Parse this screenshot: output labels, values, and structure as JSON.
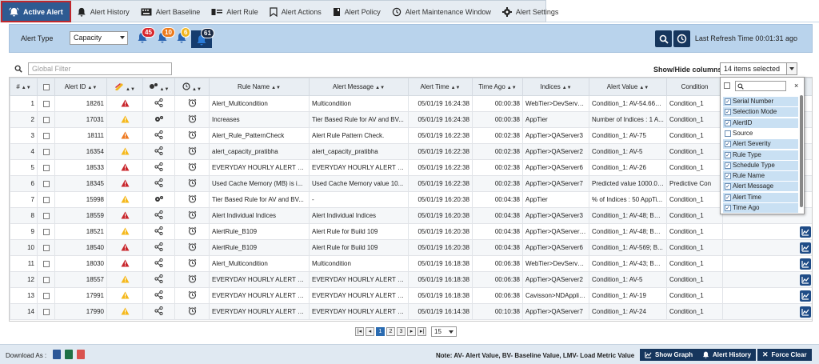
{
  "tabs": [
    {
      "label": "Active Alert",
      "icon": "bell-alert-icon"
    },
    {
      "label": "Alert History",
      "icon": "bell-icon"
    },
    {
      "label": "Alert Baseline",
      "icon": "keyboard-icon"
    },
    {
      "label": "Alert Rule",
      "icon": "rule-icon"
    },
    {
      "label": "Alert Actions",
      "icon": "bookmark-icon"
    },
    {
      "label": "Alert Policy",
      "icon": "book-icon"
    },
    {
      "label": "Alert Maintenance Window",
      "icon": "clock-reset-icon"
    },
    {
      "label": "Alert Settings",
      "icon": "gear-icon"
    }
  ],
  "toolbar": {
    "alert_type_label": "Alert Type",
    "alert_type_value": "Capacity",
    "counts": [
      {
        "value": "45",
        "color": "#d9262c"
      },
      {
        "value": "10",
        "color": "#ec7a1c"
      },
      {
        "value": "6",
        "color": "#f2b51d"
      },
      {
        "value": "61",
        "color": "#1a2a44"
      }
    ],
    "refresh_text": "Last Refresh Time 00:01:31 ago"
  },
  "filter": {
    "placeholder": "Global Filter",
    "show_hide_label": "Show/Hide columns",
    "show_hide_value": "14 items selected"
  },
  "columns": [
    "#",
    "",
    "Alert ID",
    "",
    "",
    "",
    "Rule Name",
    "Alert Message",
    "Alert Time",
    "Time Ago",
    "Indices",
    "Alert Value",
    "Condition"
  ],
  "rows": [
    {
      "n": "1",
      "id": "18261",
      "sev": "red",
      "rt": "share",
      "rule": "Alert_Multicondition",
      "msg": "Multicondition",
      "time": "05/01/19 16:24:38",
      "ago": "00:00:38",
      "idx": "WebTier>DevServer5",
      "val": "Condition_1: AV-54.667...",
      "cond": "Condition_1"
    },
    {
      "n": "2",
      "id": "17031",
      "sev": "yellow",
      "rt": "gears",
      "rule": "Increases",
      "msg": "Tier Based Rule for AV and BV...",
      "time": "05/01/19 16:24:38",
      "ago": "00:00:38",
      "idx": "AppTier",
      "val": "Number of Indices : 1 A...",
      "cond": "Condition_1"
    },
    {
      "n": "3",
      "id": "18111",
      "sev": "orange",
      "rt": "share",
      "rule": "Alert_Rule_PatternCheck",
      "msg": "Alert Rule Pattern Check.",
      "time": "05/01/19 16:22:38",
      "ago": "00:02:38",
      "idx": "AppTier>QAServer3",
      "val": "Condition_1: AV-75",
      "cond": "Condition_1"
    },
    {
      "n": "4",
      "id": "16354",
      "sev": "yellow",
      "rt": "share",
      "rule": "alert_capacity_pratibha",
      "msg": "alert_capacity_pratibha",
      "time": "05/01/19 16:22:38",
      "ago": "00:02:38",
      "idx": "AppTier>QAServer2",
      "val": "Condition_1: AV-5",
      "cond": "Condition_1"
    },
    {
      "n": "5",
      "id": "18533",
      "sev": "red",
      "rt": "share",
      "rule": "EVERYDAY HOURLY ALERT SC...",
      "msg": "EVERYDAY HOURLY ALERT SC...",
      "time": "05/01/19 16:22:38",
      "ago": "00:02:38",
      "idx": "AppTier>QAServer6",
      "val": "Condition_1: AV-26",
      "cond": "Condition_1"
    },
    {
      "n": "6",
      "id": "18345",
      "sev": "red",
      "rt": "share",
      "rule": "Used Cache Memory (MB) is i...",
      "msg": "Used Cache Memory value 10...",
      "time": "05/01/19 16:22:38",
      "ago": "00:02:38",
      "idx": "AppTier>QAServer7",
      "val": "Predicted value 1000.0 ...",
      "cond": "Predictive Con"
    },
    {
      "n": "7",
      "id": "15998",
      "sev": "yellow",
      "rt": "gears",
      "rule": "Tier Based Rule for AV and BV...",
      "msg": "-",
      "time": "05/01/19 16:20:38",
      "ago": "00:04:38",
      "idx": "AppTier",
      "val": "% of Indices : 50 AppTi...",
      "cond": "Condition_1"
    },
    {
      "n": "8",
      "id": "18559",
      "sev": "red",
      "rt": "share",
      "rule": "Alert Individual Indices",
      "msg": "Alert Individual Indices",
      "time": "05/01/19 16:20:38",
      "ago": "00:04:38",
      "idx": "AppTier>QAServer3",
      "val": "Condition_1: AV-48; BV-...",
      "cond": "Condition_1"
    },
    {
      "n": "9",
      "id": "18521",
      "sev": "yellow",
      "rt": "share",
      "rule": "AlertRule_B109",
      "msg": "Alert Rule for Build 109",
      "time": "05/01/19 16:20:38",
      "ago": "00:04:38",
      "idx": "AppTier>QAServer35",
      "val": "Condition_1: AV-48; BV-...",
      "cond": "Condition_1"
    },
    {
      "n": "10",
      "id": "18540",
      "sev": "red",
      "rt": "share",
      "rule": "AlertRule_B109",
      "msg": "Alert Rule for Build 109",
      "time": "05/01/19 16:20:38",
      "ago": "00:04:38",
      "idx": "AppTier>QAServer6",
      "val": "Condition_1: AV-569; B...",
      "cond": "Condition_1"
    },
    {
      "n": "11",
      "id": "18030",
      "sev": "red",
      "rt": "share",
      "rule": "Alert_Multicondition",
      "msg": "Multicondition",
      "time": "05/01/19 16:18:38",
      "ago": "00:06:38",
      "idx": "WebTier>DevServer6",
      "val": "Condition_1: AV-43; BV-...",
      "cond": "Condition_1"
    },
    {
      "n": "12",
      "id": "18557",
      "sev": "yellow",
      "rt": "share",
      "rule": "EVERYDAY HOURLY ALERT SC...",
      "msg": "EVERYDAY HOURLY ALERT SC...",
      "time": "05/01/19 16:18:38",
      "ago": "00:06:38",
      "idx": "AppTier>QAServer2",
      "val": "Condition_1: AV-5",
      "cond": "Condition_1"
    },
    {
      "n": "13",
      "id": "17991",
      "sev": "yellow",
      "rt": "share",
      "rule": "EVERYDAY HOURLY ALERT SC...",
      "msg": "EVERYDAY HOURLY ALERT SC...",
      "time": "05/01/19 16:18:38",
      "ago": "00:06:38",
      "idx": "Cavisson>NDAppliance",
      "val": "Condition_1: AV-19",
      "cond": "Condition_1"
    },
    {
      "n": "14",
      "id": "17990",
      "sev": "yellow",
      "rt": "share",
      "rule": "EVERYDAY HOURLY ALERT SC...",
      "msg": "EVERYDAY HOURLY ALERT SC...",
      "time": "05/01/19 16:14:38",
      "ago": "00:10:38",
      "idx": "AppTier>QAServer7",
      "val": "Condition_1: AV-24",
      "cond": "Condition_1"
    }
  ],
  "column_panel": {
    "items": [
      {
        "label": "Serial Number",
        "checked": true
      },
      {
        "label": "Selection Mode",
        "checked": true
      },
      {
        "label": "AlertID",
        "checked": true
      },
      {
        "label": "Source",
        "checked": false
      },
      {
        "label": "Alert Severity",
        "checked": true
      },
      {
        "label": "Rule Type",
        "checked": true
      },
      {
        "label": "Schedule Type",
        "checked": true
      },
      {
        "label": "Rule Name",
        "checked": true
      },
      {
        "label": "Alert Message",
        "checked": true
      },
      {
        "label": "Alert Time",
        "checked": true
      },
      {
        "label": "Time Ago",
        "checked": true
      }
    ]
  },
  "pager": {
    "pages": [
      "1",
      "2",
      "3"
    ],
    "current": "1",
    "page_size": "15"
  },
  "footer": {
    "download_label": "Download As :",
    "note": "Note: AV- Alert Value, BV- Baseline Value, LMV- Load Metric Value",
    "buttons": [
      "Show Graph",
      "Alert History",
      "Force Clear"
    ]
  },
  "colors": {
    "red": "#c8262c",
    "orange": "#ee7a22",
    "yellow": "#f5b81c",
    "navy": "#16365d"
  }
}
